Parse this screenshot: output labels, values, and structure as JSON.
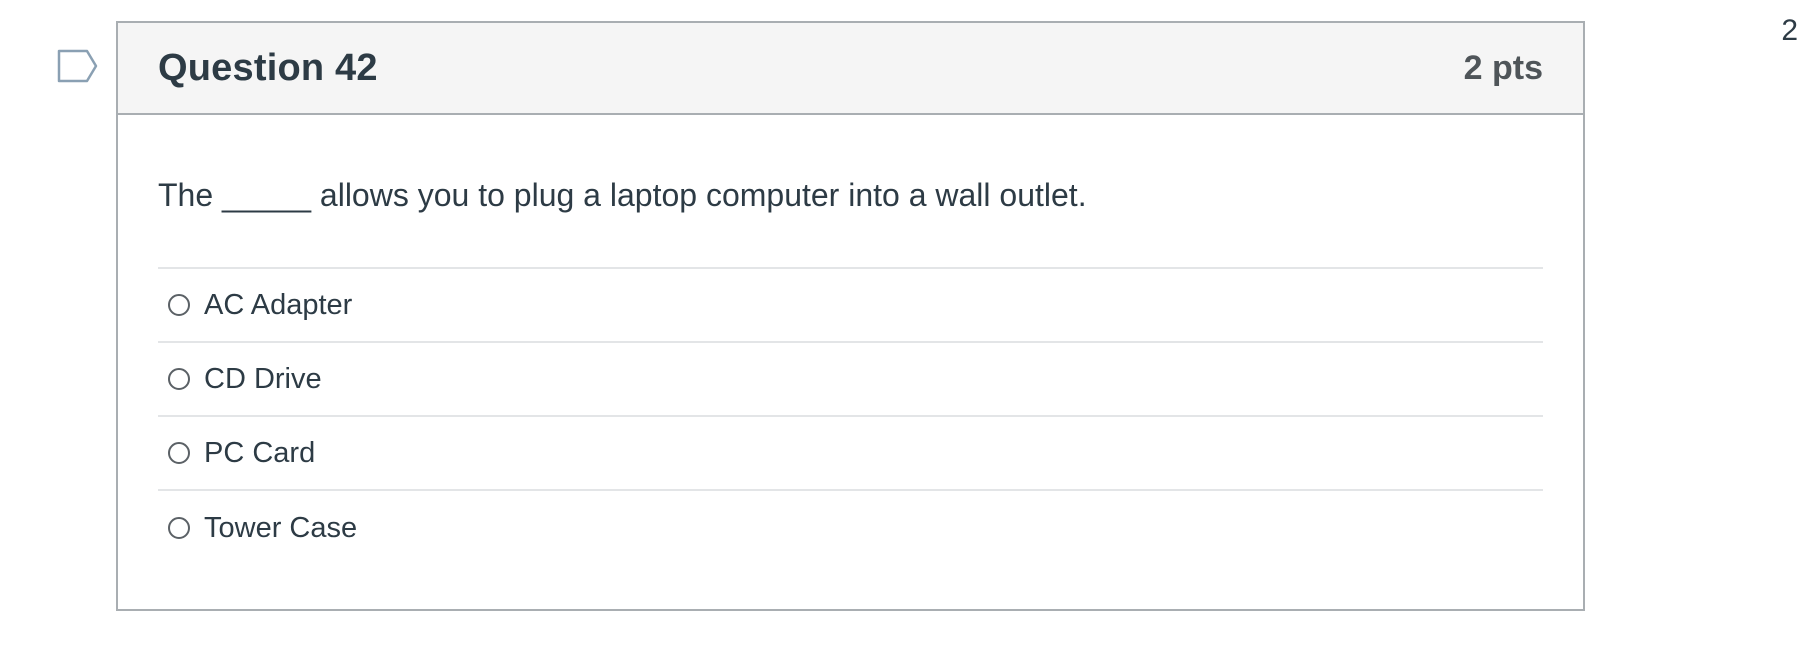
{
  "corner_number": "2",
  "flag": {
    "icon": "flag-question-icon"
  },
  "question": {
    "title": "Question 42",
    "points": "2 pts",
    "text": "The _____ allows you to plug a laptop computer into a wall outlet.",
    "answers": [
      {
        "label": "AC Adapter",
        "selected": false
      },
      {
        "label": "CD Drive",
        "selected": false
      },
      {
        "label": "PC Card",
        "selected": false
      },
      {
        "label": "Tower Case",
        "selected": false
      }
    ]
  },
  "colors": {
    "text": "#2d3b45",
    "border": "#a9aeb2",
    "header_bg": "#f5f5f5",
    "divider": "#e3e5e7",
    "flag_outline": "#8aa0b3"
  }
}
